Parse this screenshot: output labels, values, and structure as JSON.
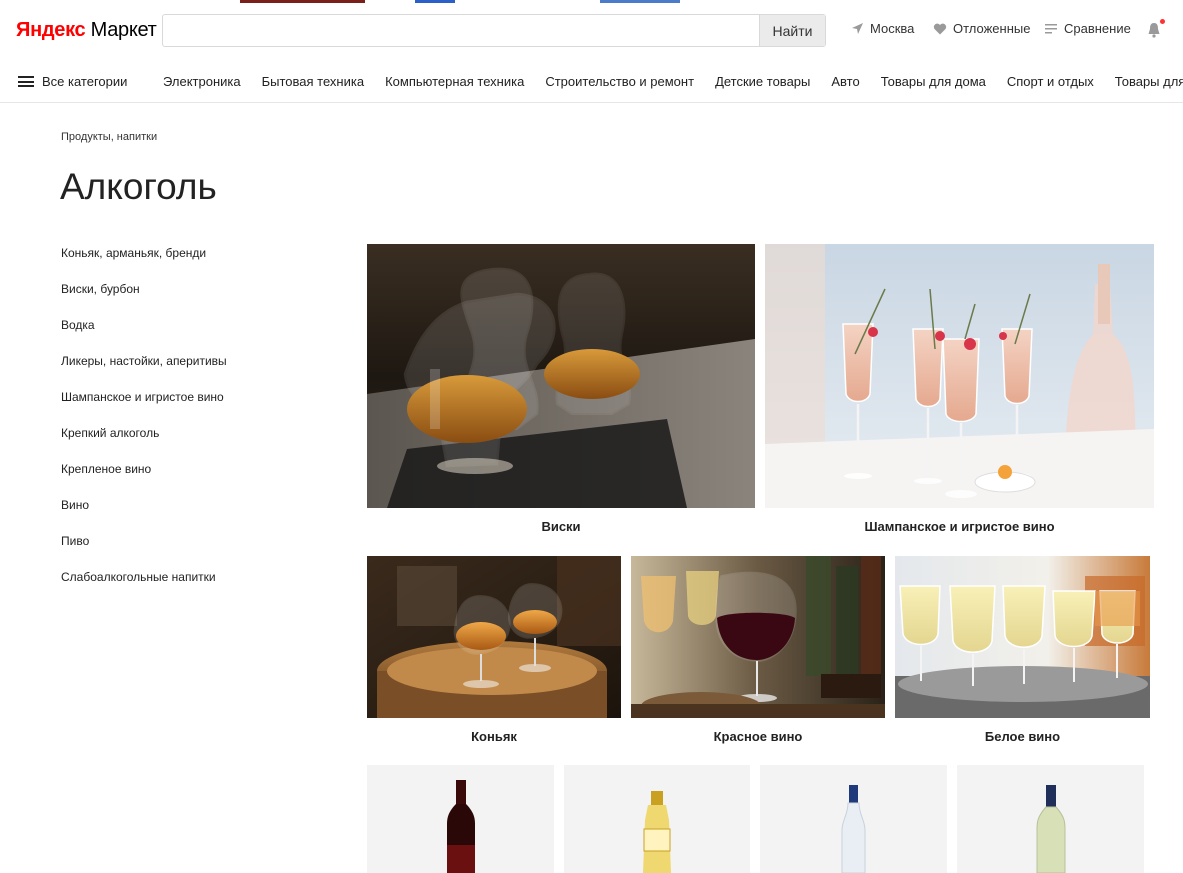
{
  "header": {
    "logo_brand": "Яндекс",
    "logo_product": "Маркет",
    "search_placeholder": "",
    "search_button": "Найти",
    "location": "Москва",
    "wishlist": "Отложенные",
    "compare": "Сравнение"
  },
  "nav": {
    "all_categories": "Все категории",
    "items": [
      "Электроника",
      "Бытовая техника",
      "Компьютерная техника",
      "Строительство и ремонт",
      "Детские товары",
      "Авто",
      "Товары для дома",
      "Спорт и отдых",
      "Товары для красоты"
    ]
  },
  "breadcrumb": "Продукты, напитки",
  "page_title": "Алкоголь",
  "sidebar": {
    "items": [
      "Коньяк, арманьяк, бренди",
      "Виски, бурбон",
      "Водка",
      "Ликеры, настойки, аперитивы",
      "Шампанское и игристое вино",
      "Крепкий алкоголь",
      "Крепленое вино",
      "Вино",
      "Пиво",
      "Слабоалкогольные напитки"
    ]
  },
  "tiles": [
    {
      "label": "Виски",
      "image": "whisky-glasses-photo"
    },
    {
      "label": "Шампанское и игристое вино",
      "image": "champagne-flutes-photo"
    },
    {
      "label": "Коньяк",
      "image": "cognac-snifters-photo"
    },
    {
      "label": "Красное вино",
      "image": "red-wine-glass-photo"
    },
    {
      "label": "Белое вино",
      "image": "white-wine-glasses-photo"
    }
  ],
  "products": [
    {
      "image": "red-wine-bottle"
    },
    {
      "image": "yellow-spirit-bottle"
    },
    {
      "image": "clear-vodka-bottle"
    },
    {
      "image": "pale-wine-bottle"
    }
  ],
  "colors": {
    "brand_red": "#ff0000",
    "search_button_bg": "#ebebeb",
    "notification_dot": "#ff3333"
  }
}
